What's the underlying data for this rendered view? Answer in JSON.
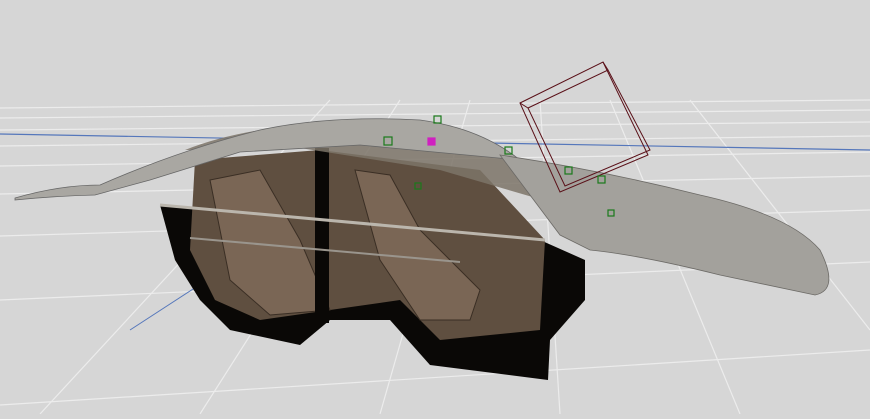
{
  "viewport": {
    "mode": "3d-perspective",
    "model": "car-cutaway",
    "colors": {
      "background": "#d6d6d6",
      "grid": "#ececec",
      "axis": "#5577bb",
      "body_silver": "#a9a7a2",
      "body_dark": "#0a0806",
      "interior": "#6b5a4a",
      "glass": "#7c7468",
      "gizmo": "#5a1018",
      "handle_green": "#1a7a1a",
      "handle_magenta": "#d020c0"
    }
  }
}
